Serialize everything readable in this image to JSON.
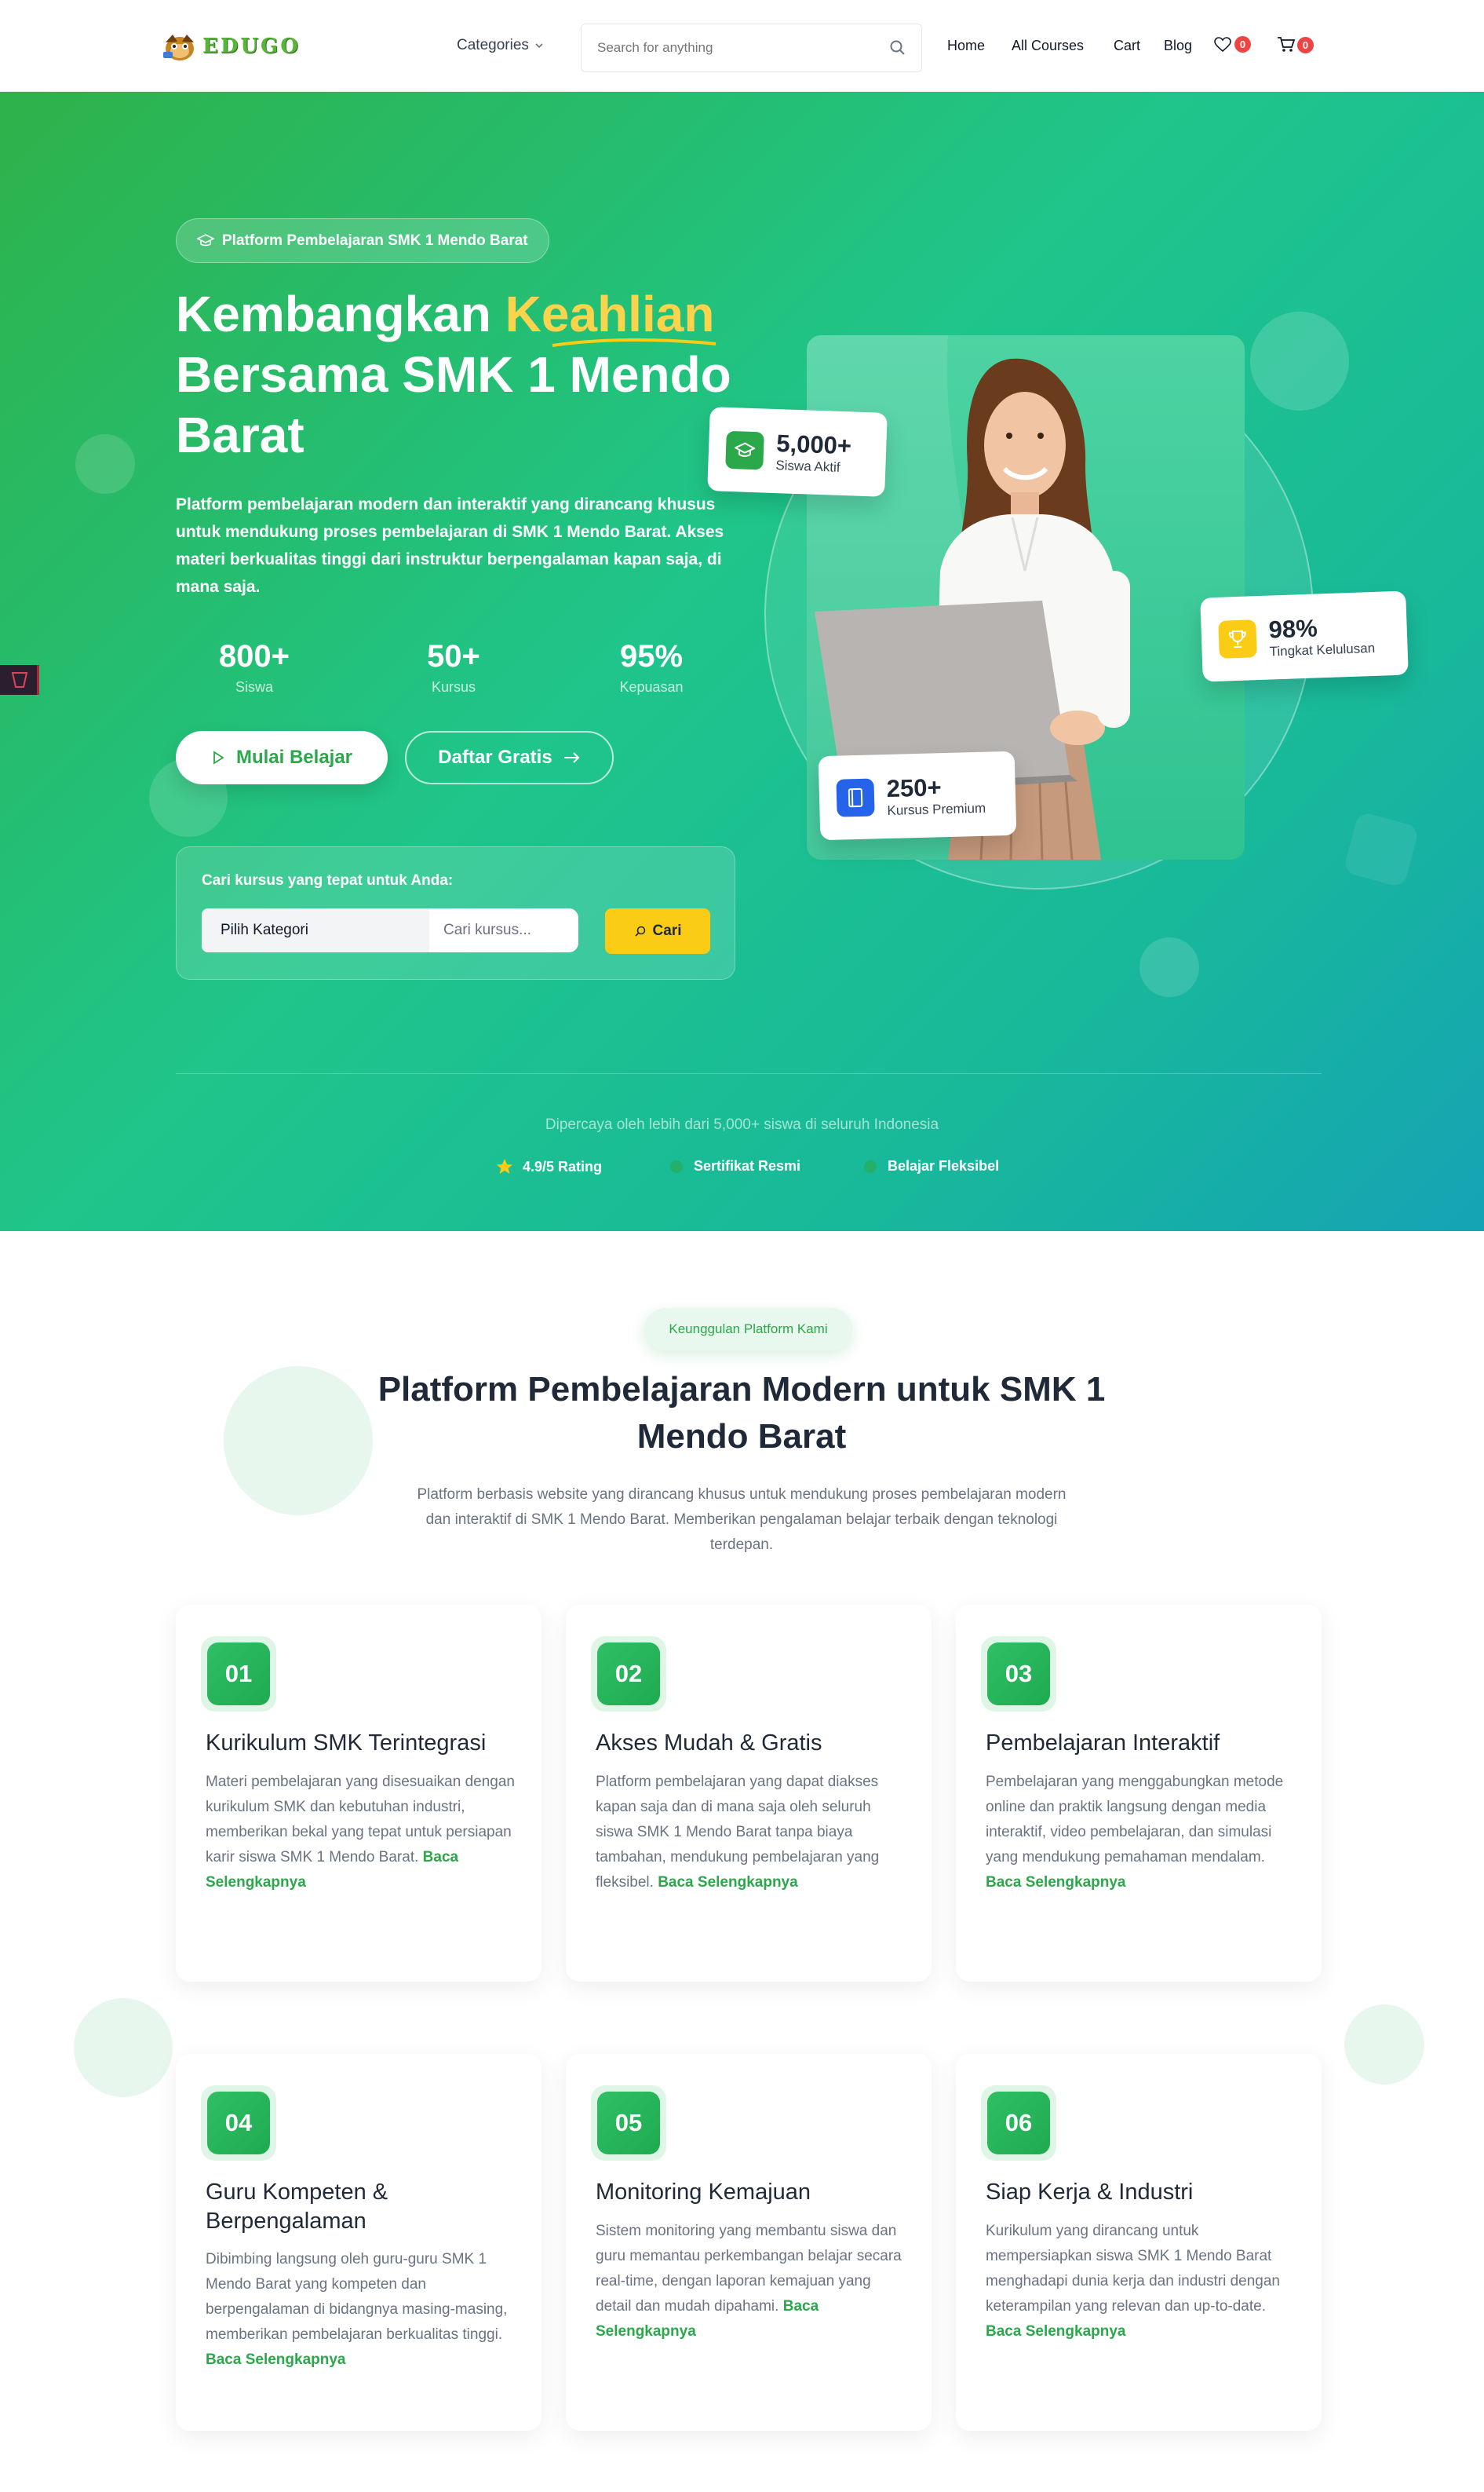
{
  "nav": {
    "logo_text": "EDUGO",
    "categories": "Categories",
    "search_placeholder": "Search for anything",
    "links": [
      "Home",
      "All Courses",
      "Cart",
      "Blog"
    ],
    "wishlist_count": "0",
    "cart_count": "0"
  },
  "hero": {
    "pill": "Platform Pembelajaran SMK 1 Mendo Barat",
    "title_part1": "Kembangkan ",
    "title_highlight": "Keahlian",
    "title_part2": "Bersama SMK 1 Mendo Barat",
    "lead": "Platform pembelajaran modern dan interaktif yang dirancang khusus untuk mendukung proses pembelajaran di SMK 1 Mendo Barat. Akses materi berkualitas tinggi dari instruktur berpengalaman kapan saja, di mana saja.",
    "stats": [
      {
        "value": "800+",
        "label": "Siswa"
      },
      {
        "value": "50+",
        "label": "Kursus"
      },
      {
        "value": "95%",
        "label": "Kepuasan"
      }
    ],
    "btn_primary": "Mulai Belajar",
    "btn_secondary": "Daftar Gratis",
    "search_title": "Cari kursus yang tepat untuk Anda:",
    "search_select": "Pilih Kategori",
    "search_placeholder": "Cari kursus...",
    "search_button": "Cari",
    "trust_text": "Dipercaya oleh lebih dari 5,000+ siswa di seluruh Indonesia",
    "trust_items": [
      "4.9/5 Rating",
      "Sertifikat Resmi",
      "Belajar Fleksibel"
    ],
    "cards": [
      {
        "value": "5,000+",
        "label": "Siswa Aktif"
      },
      {
        "value": "98%",
        "label": "Tingkat Kelulusan"
      },
      {
        "value": "250+",
        "label": "Kursus Premium"
      }
    ]
  },
  "features": {
    "pill": "Keunggulan Platform Kami",
    "title": "Platform Pembelajaran Modern untuk SMK 1 Mendo Barat",
    "subtitle": "Platform berbasis website yang dirancang khusus untuk mendukung proses pembelajaran modern dan interaktif di SMK 1 Mendo Barat. Memberikan pengalaman belajar terbaik dengan teknologi terdepan.",
    "more_label": "Baca Selengkapnya",
    "items": [
      {
        "num": "01",
        "title": "Kurikulum SMK Terintegrasi",
        "desc": "Materi pembelajaran yang disesuaikan dengan kurikulum SMK dan kebutuhan industri, memberikan bekal yang tepat untuk persiapan karir siswa SMK 1 Mendo Barat."
      },
      {
        "num": "02",
        "title": "Akses Mudah & Gratis",
        "desc": "Platform pembelajaran yang dapat diakses kapan saja dan di mana saja oleh seluruh siswa SMK 1 Mendo Barat tanpa biaya tambahan, mendukung pembelajaran yang fleksibel."
      },
      {
        "num": "03",
        "title": "Pembelajaran Interaktif",
        "desc": "Pembelajaran yang menggabungkan metode online dan praktik langsung dengan media interaktif, video pembelajaran, dan simulasi yang mendukung pemahaman mendalam."
      },
      {
        "num": "04",
        "title": "Guru Kompeten & Berpengalaman",
        "desc": "Dibimbing langsung oleh guru-guru SMK 1 Mendo Barat yang kompeten dan berpengalaman di bidangnya masing-masing, memberikan pembelajaran berkualitas tinggi."
      },
      {
        "num": "05",
        "title": "Monitoring Kemajuan",
        "desc": "Sistem monitoring yang membantu siswa dan guru memantau perkembangan belajar secara real-time, dengan laporan kemajuan yang detail dan mudah dipahami."
      },
      {
        "num": "06",
        "title": "Siap Kerja & Industri",
        "desc": "Kurikulum yang dirancang untuk mempersiapkan siswa SMK 1 Mendo Barat menghadapi dunia kerja dan industri dengan keterampilan yang relevan dan up-to-date."
      }
    ]
  }
}
